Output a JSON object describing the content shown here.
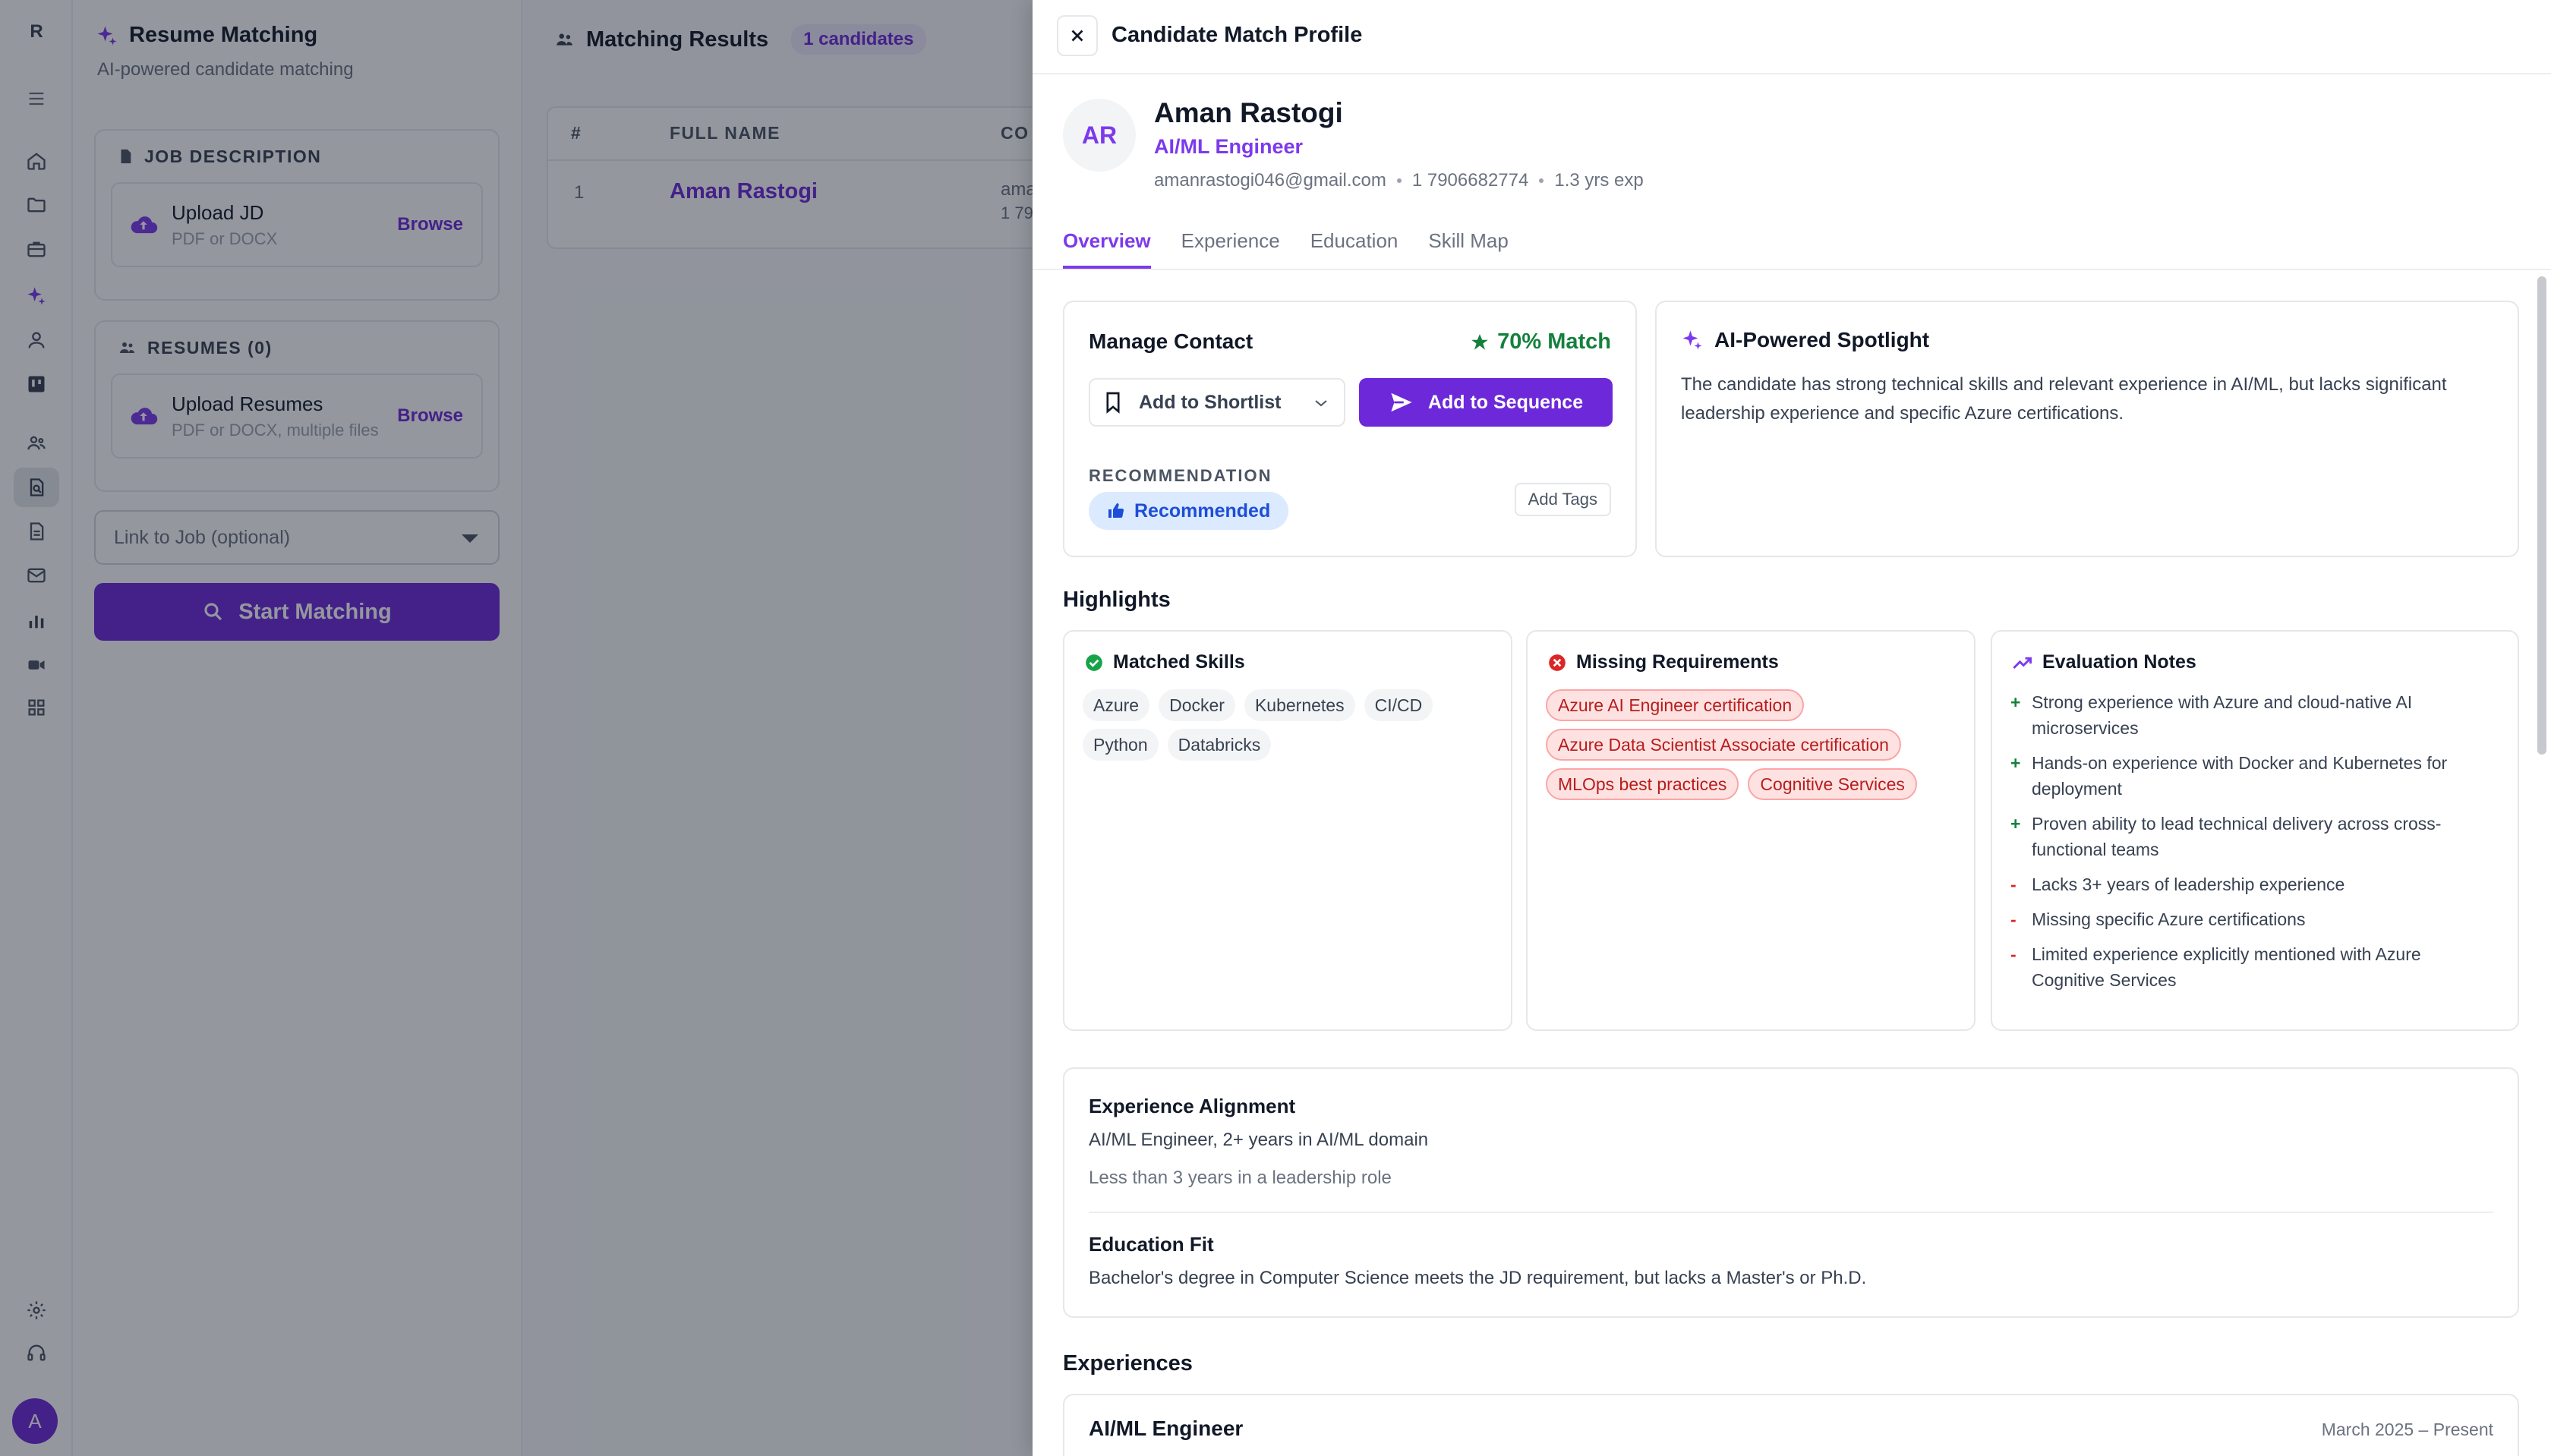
{
  "rail": {
    "logo": "R",
    "avatar": "A"
  },
  "left_panel": {
    "title": "Resume Matching",
    "subtitle": "AI-powered candidate matching",
    "job_description": {
      "heading": "JOB DESCRIPTION",
      "upload_title": "Upload JD",
      "upload_hint": "PDF or DOCX",
      "browse": "Browse"
    },
    "resumes": {
      "heading": "RESUMES (0)",
      "upload_title": "Upload Resumes",
      "upload_hint": "PDF or DOCX, multiple files",
      "browse": "Browse"
    },
    "link_job_placeholder": "Link to Job (optional)",
    "start_button": "Start Matching"
  },
  "results": {
    "title": "Matching Results",
    "count_badge": "1 candidates",
    "columns": [
      "#",
      "FULL NAME",
      "CO"
    ],
    "rows": [
      {
        "index": "1",
        "name": "Aman Rastogi",
        "contact_line1": "ama",
        "contact_line2": "1 79"
      }
    ]
  },
  "drawer": {
    "title": "Candidate Match Profile",
    "profile": {
      "initials": "AR",
      "name": "Aman Rastogi",
      "role": "AI/ML Engineer",
      "email": "amanrastogi046@gmail.com",
      "phone": "1 7906682774",
      "experience": "1.3 yrs exp"
    },
    "tabs": [
      "Overview",
      "Experience",
      "Education",
      "Skill Map"
    ],
    "active_tab": "Overview",
    "manage_contact": {
      "title": "Manage Contact",
      "match": "70% Match",
      "shortlist_label": "Add to Shortlist",
      "sequence_label": "Add to Sequence",
      "recommendation_label": "RECOMMENDATION",
      "recommendation_value": "Recommended",
      "add_tags": "Add Tags"
    },
    "spotlight": {
      "title": "AI-Powered Spotlight",
      "text": "The candidate has strong technical skills and relevant experience in AI/ML, but lacks significant leadership experience and specific Azure certifications."
    },
    "highlights": {
      "title": "Highlights",
      "matched": {
        "title": "Matched Skills",
        "skills": [
          "Azure",
          "Docker",
          "Kubernetes",
          "CI/CD",
          "Python",
          "Databricks"
        ]
      },
      "missing": {
        "title": "Missing Requirements",
        "items": [
          "Azure AI Engineer certification",
          "Azure Data Scientist Associate certification",
          "MLOps best practices",
          "Cognitive Services"
        ]
      },
      "evaluation": {
        "title": "Evaluation Notes",
        "notes": [
          {
            "sign": "+",
            "text": "Strong experience with Azure and cloud-native AI microservices"
          },
          {
            "sign": "+",
            "text": "Hands-on experience with Docker and Kubernetes for deployment"
          },
          {
            "sign": "+",
            "text": "Proven ability to lead technical delivery across cross-functional teams"
          },
          {
            "sign": "-",
            "text": "Lacks 3+ years of leadership experience"
          },
          {
            "sign": "-",
            "text": "Missing specific Azure certifications"
          },
          {
            "sign": "-",
            "text": "Limited experience explicitly mentioned with Azure Cognitive Services"
          }
        ]
      }
    },
    "alignment": {
      "experience_title": "Experience Alignment",
      "experience_text": "AI/ML Engineer, 2+ years in AI/ML domain",
      "experience_note": "Less than 3 years in a leadership role",
      "education_title": "Education Fit",
      "education_text": "Bachelor's degree in Computer Science meets the JD requirement, but lacks a Master's or Ph.D."
    },
    "experiences": {
      "title": "Experiences",
      "items": [
        {
          "role": "AI/ML Engineer",
          "dates": "March 2025 – Present"
        }
      ]
    }
  }
}
